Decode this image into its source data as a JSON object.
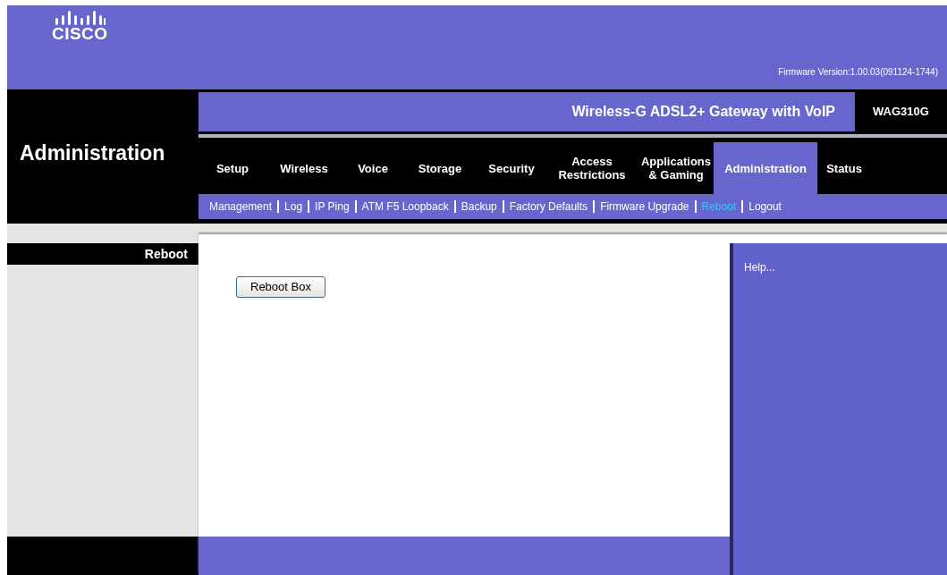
{
  "header": {
    "logo": "CISCO",
    "firmware": "Firmware Version:1.00.03(091124-1744)"
  },
  "product": {
    "name": "Wireless-G ADSL2+ Gateway with VoIP",
    "model": "WAG310G"
  },
  "section_title": "Administration",
  "tabs": [
    {
      "label": "Setup",
      "selected": false
    },
    {
      "label": "Wireless",
      "selected": false
    },
    {
      "label": "Voice",
      "selected": false
    },
    {
      "label": "Storage",
      "selected": false
    },
    {
      "label": "Security",
      "selected": false
    },
    {
      "label": "Access Restrictions",
      "selected": false
    },
    {
      "label": "Applications & Gaming",
      "selected": false
    },
    {
      "label": "Administration",
      "selected": true
    },
    {
      "label": "Status",
      "selected": false
    }
  ],
  "subtabs": [
    {
      "label": "Management",
      "selected": false
    },
    {
      "label": "Log",
      "selected": false
    },
    {
      "label": "IP Ping",
      "selected": false
    },
    {
      "label": "ATM F5 Loopback",
      "selected": false
    },
    {
      "label": "Backup",
      "selected": false
    },
    {
      "label": "Factory Defaults",
      "selected": false
    },
    {
      "label": "Firmware Upgrade",
      "selected": false
    },
    {
      "label": "Reboot",
      "selected": true
    },
    {
      "label": "Logout",
      "selected": false
    }
  ],
  "sidebar": {
    "heading": "Reboot"
  },
  "content": {
    "button": "Reboot Box"
  },
  "help": {
    "text": "Help..."
  }
}
